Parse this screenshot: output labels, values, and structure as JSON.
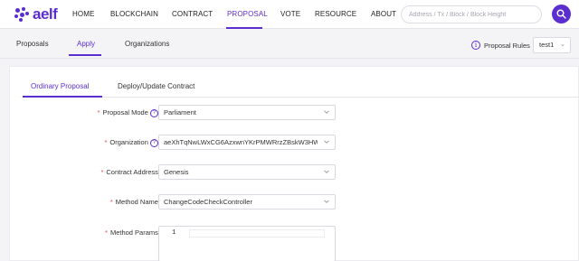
{
  "brand": {
    "name": "aelf",
    "color": "#5b2ecf"
  },
  "nav": {
    "items": [
      "HOME",
      "BLOCKCHAIN",
      "CONTRACT",
      "PROPOSAL",
      "VOTE",
      "RESOURCE",
      "ABOUT"
    ],
    "active": "PROPOSAL"
  },
  "search": {
    "placeholder": "Address / Tx / Block / Block Height",
    "value": ""
  },
  "subtabs": {
    "items": [
      "Proposals",
      "Apply",
      "Organizations"
    ],
    "active": "Apply"
  },
  "rules": {
    "label": "Proposal Rules",
    "selected": "test1"
  },
  "inner_tabs": {
    "items": [
      "Ordinary Proposal",
      "Deploy/Update Contract"
    ],
    "active": "Ordinary Proposal"
  },
  "form": {
    "proposal_mode": {
      "label": "Proposal Mode",
      "value": "Parliament",
      "has_help": true
    },
    "organization": {
      "label": "Organization",
      "value": "aeXhTqNwLWxCG6AzxwnYKrPMWRrzZBskW3HWVMrW...",
      "has_help": true
    },
    "contract_address": {
      "label": "Contract Address",
      "value": "Genesis"
    },
    "method_name": {
      "label": "Method Name",
      "value": "ChangeCodeCheckController"
    },
    "method_params": {
      "label": "Method Params",
      "line_number": "1"
    }
  },
  "colors": {
    "accent": "#5b2ecf",
    "required": "#e0474c"
  },
  "icons": {
    "search": "search-icon",
    "info": "info-icon",
    "help": "question-icon",
    "chevron": "chevron-down-icon"
  }
}
